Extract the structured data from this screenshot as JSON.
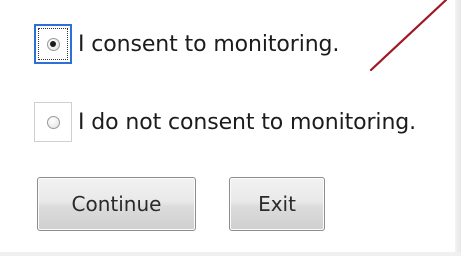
{
  "consent_form": {
    "options": [
      {
        "label": "I consent to monitoring.",
        "selected": true
      },
      {
        "label": "I do not consent to monitoring.",
        "selected": false
      }
    ],
    "buttons": {
      "continue_label": "Continue",
      "exit_label": "Exit"
    }
  },
  "colors": {
    "annotation_arrow": "#a01824",
    "focus_border": "#2f6fd8"
  }
}
